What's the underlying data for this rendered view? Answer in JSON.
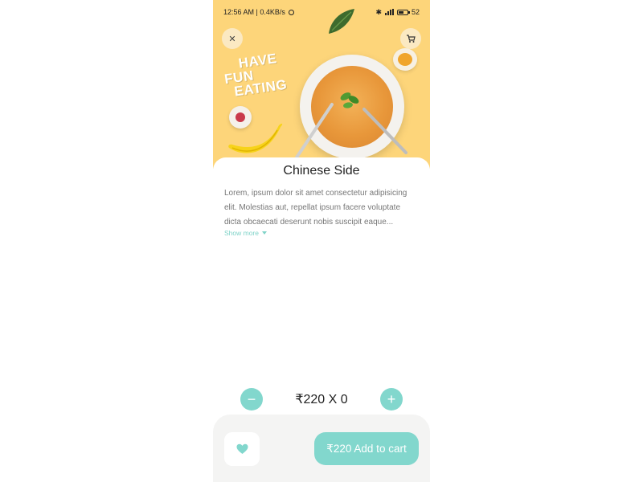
{
  "status_bar": {
    "left": "12:56 AM | 0.4KB/s",
    "battery": "52"
  },
  "hero": {
    "promo_text_line1": "HAVE",
    "promo_text_line2": "FUN",
    "promo_text_line3": "EATING",
    "close_glyph": "✕",
    "cart_glyph": "🛒"
  },
  "product": {
    "title": "Chinese Side",
    "description": "Lorem, ipsum dolor sit amet consectetur adipisicing elit. Molestias aut, repellat ipsum facere voluptate dicta obcaecati deserunt nobis suscipit eaque...",
    "show_more": "Show more"
  },
  "quantity": {
    "minus_glyph": "−",
    "plus_glyph": "+",
    "label": "₹220 X 0"
  },
  "actions": {
    "add_to_cart": "₹220 Add to cart"
  },
  "colors": {
    "accent": "#82d7cd",
    "hero_bg": "#fdd57a",
    "bottom_bar": "#f4f4f3"
  }
}
